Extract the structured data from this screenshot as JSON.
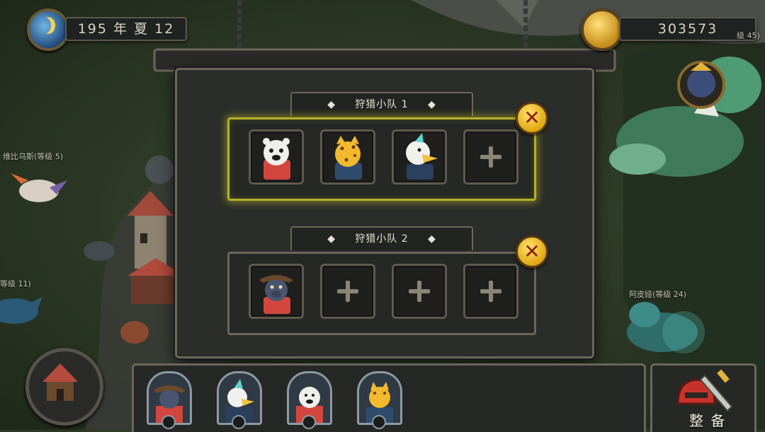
{
  "hud": {
    "date_text": "195 年 夏 12",
    "gold_amount": "303573",
    "level_fragment": "级 45)"
  },
  "world_labels": {
    "creature_left": "维比乌斯(等级 5)",
    "creature_left_low": "等级 11)",
    "creature_right": "阿皮娅(等级 24)"
  },
  "teams": [
    {
      "title": "狩猎小队 1",
      "selected": true,
      "slots": [
        {
          "filled": true,
          "icon": "polar-bear-portrait"
        },
        {
          "filled": true,
          "icon": "leopard-portrait"
        },
        {
          "filled": true,
          "icon": "eagle-portrait"
        },
        {
          "filled": false,
          "icon": "plus-icon"
        }
      ]
    },
    {
      "title": "狩猎小队 2",
      "selected": false,
      "slots": [
        {
          "filled": true,
          "icon": "boar-pirate-portrait"
        },
        {
          "filled": false,
          "icon": "plus-icon"
        },
        {
          "filled": false,
          "icon": "plus-icon"
        },
        {
          "filled": false,
          "icon": "plus-icon"
        }
      ]
    }
  ],
  "roster": [
    {
      "icon": "boar-pirate-portrait",
      "badge": "shield-icon"
    },
    {
      "icon": "eagle-portrait",
      "badge": "paw-icon"
    },
    {
      "icon": "polar-bear-portrait",
      "badge": "sword-icon"
    },
    {
      "icon": "leopard-portrait",
      "badge": "bow-icon"
    }
  ],
  "equip_button": {
    "label": "整 备",
    "icon": "helmet-sword-icon"
  },
  "colors": {
    "accent_gold": "#e0a712",
    "selected_glow": "#b6b02a",
    "frame": "#6b6658",
    "panel_bg": "#2b2d2a"
  }
}
